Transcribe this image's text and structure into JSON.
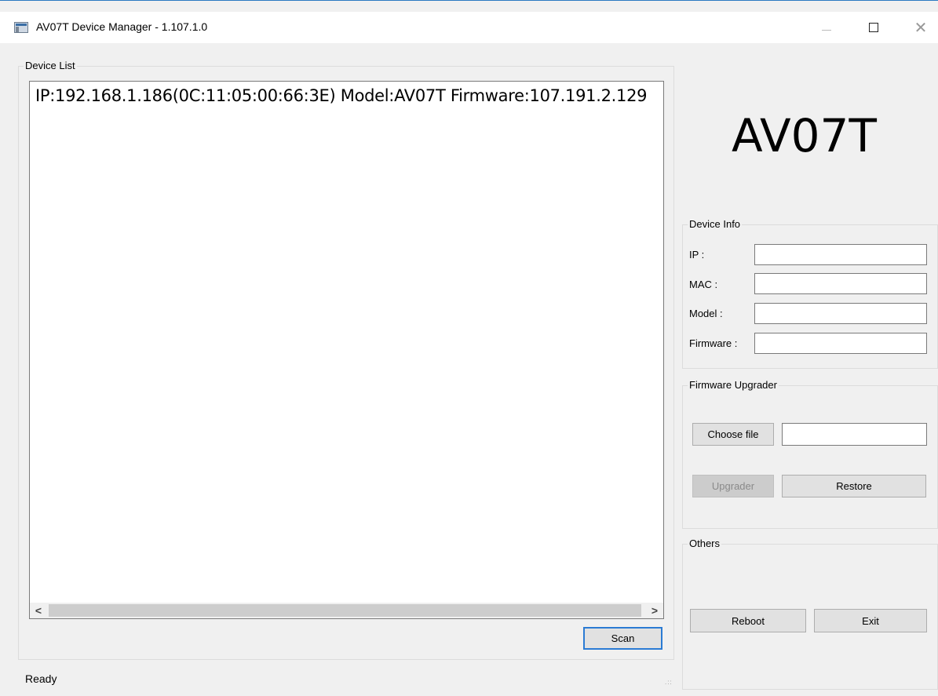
{
  "window": {
    "title": "AV07T Device Manager - 1.107.1.0",
    "min_glyph": "",
    "close_glyph": "✕"
  },
  "device_list": {
    "legend": "Device List",
    "rows": [
      "IP:192.168.1.186(0C:11:05:00:66:3E)  Model:AV07T  Firmware:107.191.2.129"
    ],
    "scroll_left": "<",
    "scroll_right": ">",
    "scan_label": "Scan"
  },
  "model_display": "AV07T",
  "device_info": {
    "legend": "Device Info",
    "ip_label": "IP :",
    "mac_label": "MAC :",
    "model_label": "Model :",
    "firmware_label": "Firmware :",
    "ip_value": "",
    "mac_value": "",
    "model_value": "",
    "firmware_value": ""
  },
  "firmware_upgrader": {
    "legend": "Firmware Upgrader",
    "choose_file_label": "Choose file",
    "file_value": "",
    "upgrader_label": "Upgrader",
    "restore_label": "Restore"
  },
  "others": {
    "legend": "Others",
    "reboot_label": "Reboot",
    "exit_label": "Exit"
  },
  "status": {
    "text": "Ready",
    "grip": ".::"
  }
}
